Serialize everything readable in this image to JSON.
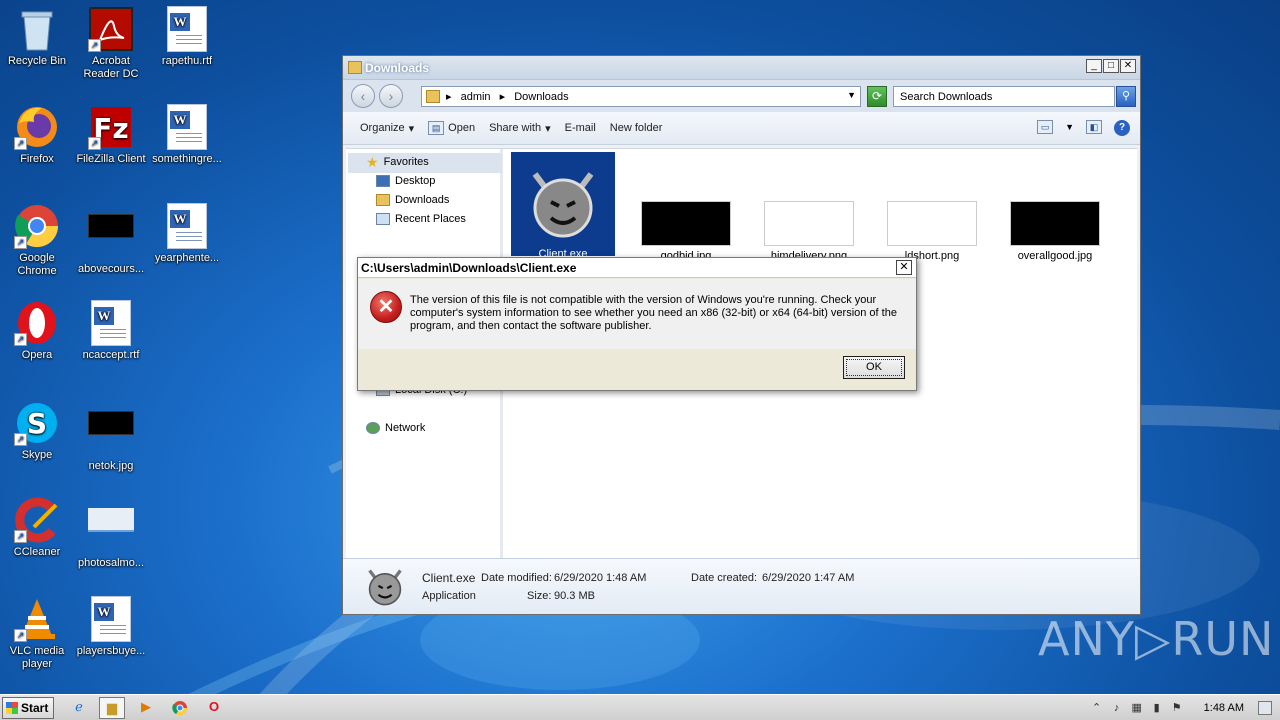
{
  "desktop": {
    "icons": [
      {
        "label": "Recycle Bin"
      },
      {
        "label": "Acrobat Reader DC"
      },
      {
        "label": "rapethu.rtf"
      },
      {
        "label": "Firefox"
      },
      {
        "label": "FileZilla Client"
      },
      {
        "label": "somethingre..."
      },
      {
        "label": "Google Chrome"
      },
      {
        "label": "abovecours..."
      },
      {
        "label": "yearphente..."
      },
      {
        "label": "Opera"
      },
      {
        "label": "ncaccept.rtf"
      },
      {
        "label": "Skype"
      },
      {
        "label": "netok.jpg"
      },
      {
        "label": "CCleaner"
      },
      {
        "label": "photosalmo..."
      },
      {
        "label": "VLC media player"
      },
      {
        "label": "playersbuye..."
      }
    ]
  },
  "explorer": {
    "title": "Downloads",
    "breadcrumbs": [
      "admin",
      "Downloads"
    ],
    "search_placeholder": "Search Downloads",
    "commands": {
      "organize": "Organize",
      "open": "Open",
      "share_with": "Share with",
      "email": "E-mail",
      "new_folder": "New folder"
    },
    "nav": {
      "favorites": "Favorites",
      "desktop": "Desktop",
      "downloads": "Downloads",
      "recent_places": "Recent Places",
      "local_disk": "Local Disk (C:)",
      "network": "Network"
    },
    "files": [
      {
        "name": "Client.exe"
      },
      {
        "name": "godbid.jpg"
      },
      {
        "name": "himdelivery.png"
      },
      {
        "name": "ldshort.png"
      },
      {
        "name": "overallgood.jpg"
      }
    ],
    "details": {
      "name": "Client.exe",
      "type": "Application",
      "modified_label": "Date modified:",
      "modified_value": "6/29/2020 1:48 AM",
      "created_label": "Date created:",
      "created_value": "6/29/2020 1:47 AM",
      "size_label": "Size:",
      "size_value": "90.3 MB"
    }
  },
  "dialog": {
    "title": "C:\\Users\\admin\\Downloads\\Client.exe",
    "message": "The version of this file is not compatible with the version of Windows you're running. Check your computer's system information to see whether you need an x86 (32-bit) or x64 (64-bit) version of the program, and then contact the software publisher.",
    "ok_label": "OK"
  },
  "taskbar": {
    "start_label": "Start",
    "clock": "1:48 AM"
  },
  "watermark": "ANY▷RUN"
}
